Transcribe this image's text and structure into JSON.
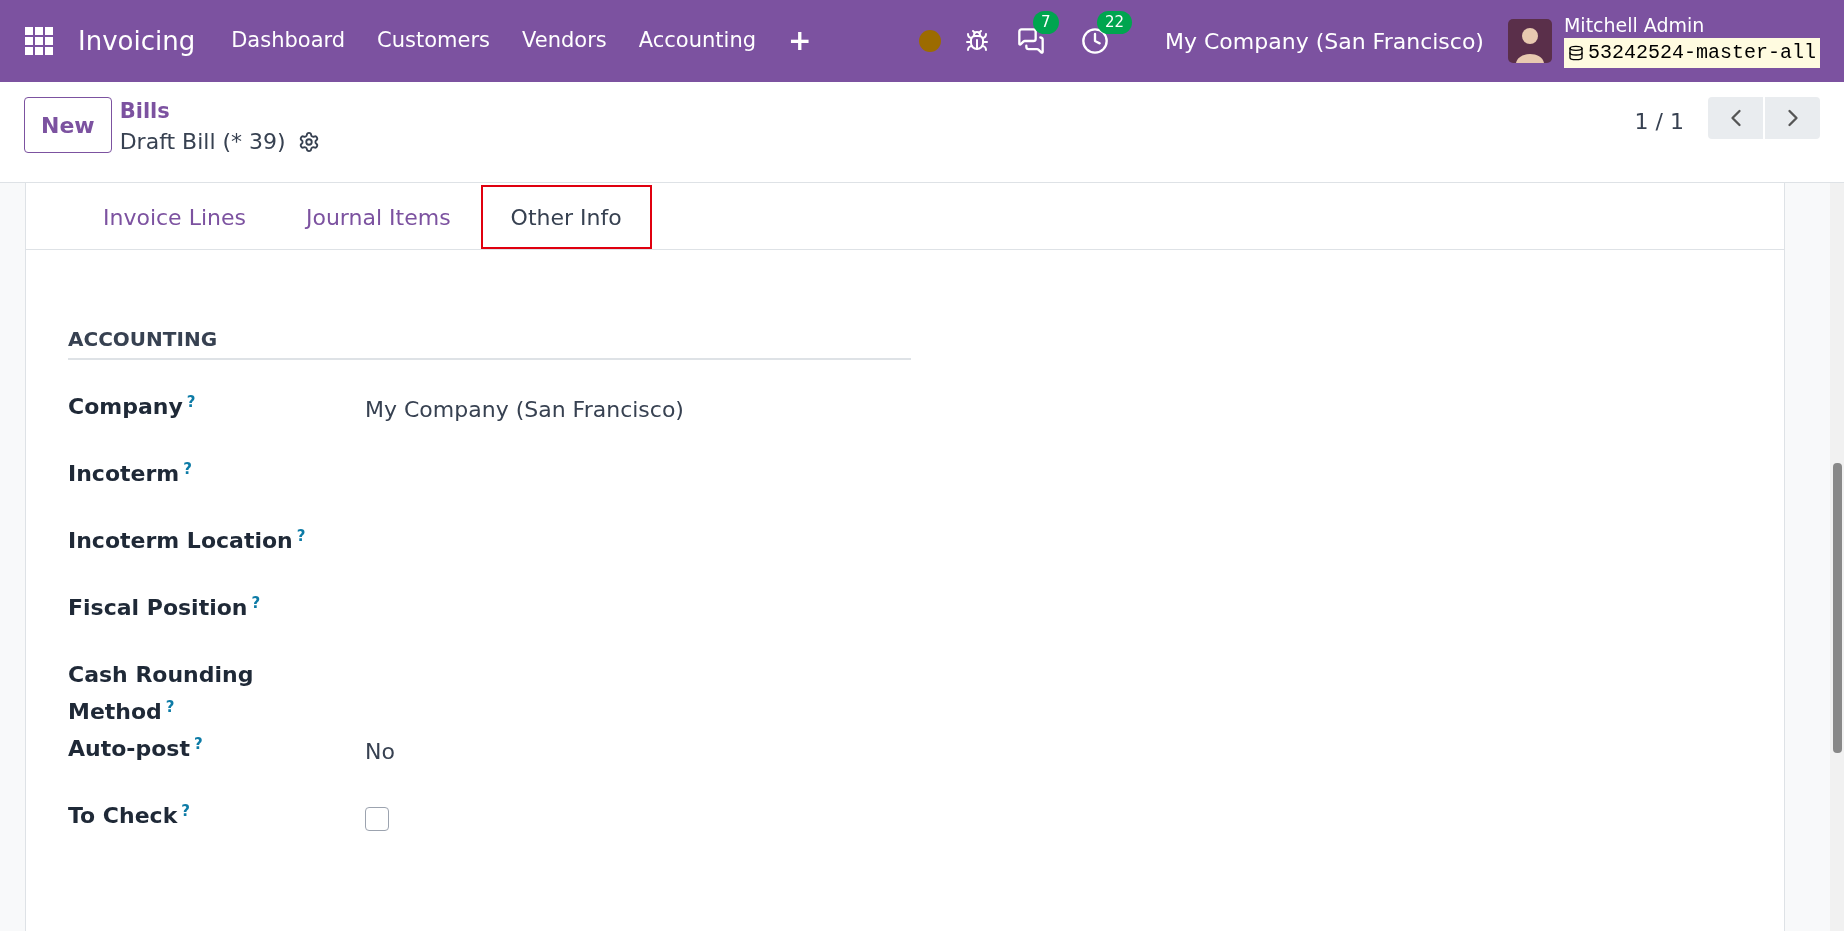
{
  "navbar": {
    "app_name": "Invoicing",
    "menu": [
      "Dashboard",
      "Customers",
      "Vendors",
      "Accounting"
    ],
    "plus": "+",
    "messages_count": "7",
    "activities_count": "22",
    "company": "My Company (San Francisco)",
    "user": "Mitchell Admin",
    "database": "53242524-master-all"
  },
  "control_panel": {
    "new_button": "New",
    "breadcrumb": "Bills",
    "record": "Draft Bill (* 39)",
    "pager": "1 / 1"
  },
  "tabs": [
    {
      "label": "Invoice Lines",
      "selected": false,
      "highlighted": false
    },
    {
      "label": "Journal Items",
      "selected": false,
      "highlighted": false
    },
    {
      "label": "Other Info",
      "selected": true,
      "highlighted": true
    }
  ],
  "section": {
    "title": "ACCOUNTING",
    "fields": [
      {
        "label": "Company",
        "help": "?",
        "kind": "text",
        "value": "My Company (San Francisco)"
      },
      {
        "label": "Incoterm",
        "help": "?",
        "kind": "text"
      },
      {
        "label": "Incoterm Location",
        "help": "?",
        "kind": "text"
      },
      {
        "label": "Fiscal Position",
        "help": "?",
        "kind": "text"
      },
      {
        "label": "Cash Rounding Method",
        "help": "?",
        "kind": "text"
      },
      {
        "label": "Auto-post",
        "help": "?",
        "kind": "text",
        "value": "No"
      },
      {
        "label": "To Check",
        "help": "?",
        "kind": "checkbox",
        "checked": false
      }
    ]
  }
}
